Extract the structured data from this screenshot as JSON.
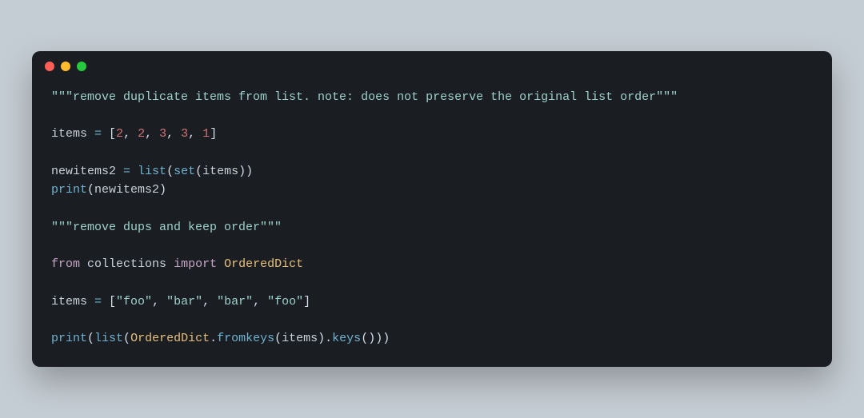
{
  "window": {
    "traffic_lights": [
      "red",
      "yellow",
      "green"
    ]
  },
  "code": {
    "lines": [
      [
        {
          "cls": "tk-str",
          "t": "\"\"\"remove duplicate items from list. note: does not preserve the original list order\"\"\""
        }
      ],
      [],
      [
        {
          "cls": "tk-var",
          "t": "items "
        },
        {
          "cls": "tk-op",
          "t": "="
        },
        {
          "cls": "tk-punc",
          "t": " ["
        },
        {
          "cls": "tk-num",
          "t": "2"
        },
        {
          "cls": "tk-punc",
          "t": ", "
        },
        {
          "cls": "tk-num",
          "t": "2"
        },
        {
          "cls": "tk-punc",
          "t": ", "
        },
        {
          "cls": "tk-num",
          "t": "3"
        },
        {
          "cls": "tk-punc",
          "t": ", "
        },
        {
          "cls": "tk-num",
          "t": "3"
        },
        {
          "cls": "tk-punc",
          "t": ", "
        },
        {
          "cls": "tk-num",
          "t": "1"
        },
        {
          "cls": "tk-punc",
          "t": "]"
        }
      ],
      [],
      [
        {
          "cls": "tk-var",
          "t": "newitems2 "
        },
        {
          "cls": "tk-op",
          "t": "="
        },
        {
          "cls": "tk-var",
          "t": " "
        },
        {
          "cls": "tk-builtin",
          "t": "list"
        },
        {
          "cls": "tk-punc",
          "t": "("
        },
        {
          "cls": "tk-builtin",
          "t": "set"
        },
        {
          "cls": "tk-punc",
          "t": "("
        },
        {
          "cls": "tk-var",
          "t": "items"
        },
        {
          "cls": "tk-punc",
          "t": "))"
        }
      ],
      [
        {
          "cls": "tk-builtin",
          "t": "print"
        },
        {
          "cls": "tk-punc",
          "t": "("
        },
        {
          "cls": "tk-var",
          "t": "newitems2"
        },
        {
          "cls": "tk-punc",
          "t": ")"
        }
      ],
      [],
      [
        {
          "cls": "tk-str",
          "t": "\"\"\"remove dups and keep order\"\"\""
        }
      ],
      [],
      [
        {
          "cls": "tk-kw",
          "t": "from"
        },
        {
          "cls": "tk-var",
          "t": " "
        },
        {
          "cls": "tk-mod",
          "t": "collections"
        },
        {
          "cls": "tk-var",
          "t": " "
        },
        {
          "cls": "tk-kw",
          "t": "import"
        },
        {
          "cls": "tk-var",
          "t": " "
        },
        {
          "cls": "tk-type",
          "t": "OrderedDict"
        }
      ],
      [],
      [
        {
          "cls": "tk-var",
          "t": "items "
        },
        {
          "cls": "tk-op",
          "t": "="
        },
        {
          "cls": "tk-punc",
          "t": " ["
        },
        {
          "cls": "tk-str",
          "t": "\"foo\""
        },
        {
          "cls": "tk-punc",
          "t": ", "
        },
        {
          "cls": "tk-str",
          "t": "\"bar\""
        },
        {
          "cls": "tk-punc",
          "t": ", "
        },
        {
          "cls": "tk-str",
          "t": "\"bar\""
        },
        {
          "cls": "tk-punc",
          "t": ", "
        },
        {
          "cls": "tk-str",
          "t": "\"foo\""
        },
        {
          "cls": "tk-punc",
          "t": "]"
        }
      ],
      [],
      [
        {
          "cls": "tk-builtin",
          "t": "print"
        },
        {
          "cls": "tk-punc",
          "t": "("
        },
        {
          "cls": "tk-builtin",
          "t": "list"
        },
        {
          "cls": "tk-punc",
          "t": "("
        },
        {
          "cls": "tk-type",
          "t": "OrderedDict"
        },
        {
          "cls": "tk-punc",
          "t": "."
        },
        {
          "cls": "tk-method",
          "t": "fromkeys"
        },
        {
          "cls": "tk-punc",
          "t": "("
        },
        {
          "cls": "tk-var",
          "t": "items"
        },
        {
          "cls": "tk-punc",
          "t": ")."
        },
        {
          "cls": "tk-method",
          "t": "keys"
        },
        {
          "cls": "tk-punc",
          "t": "()))"
        }
      ]
    ]
  }
}
